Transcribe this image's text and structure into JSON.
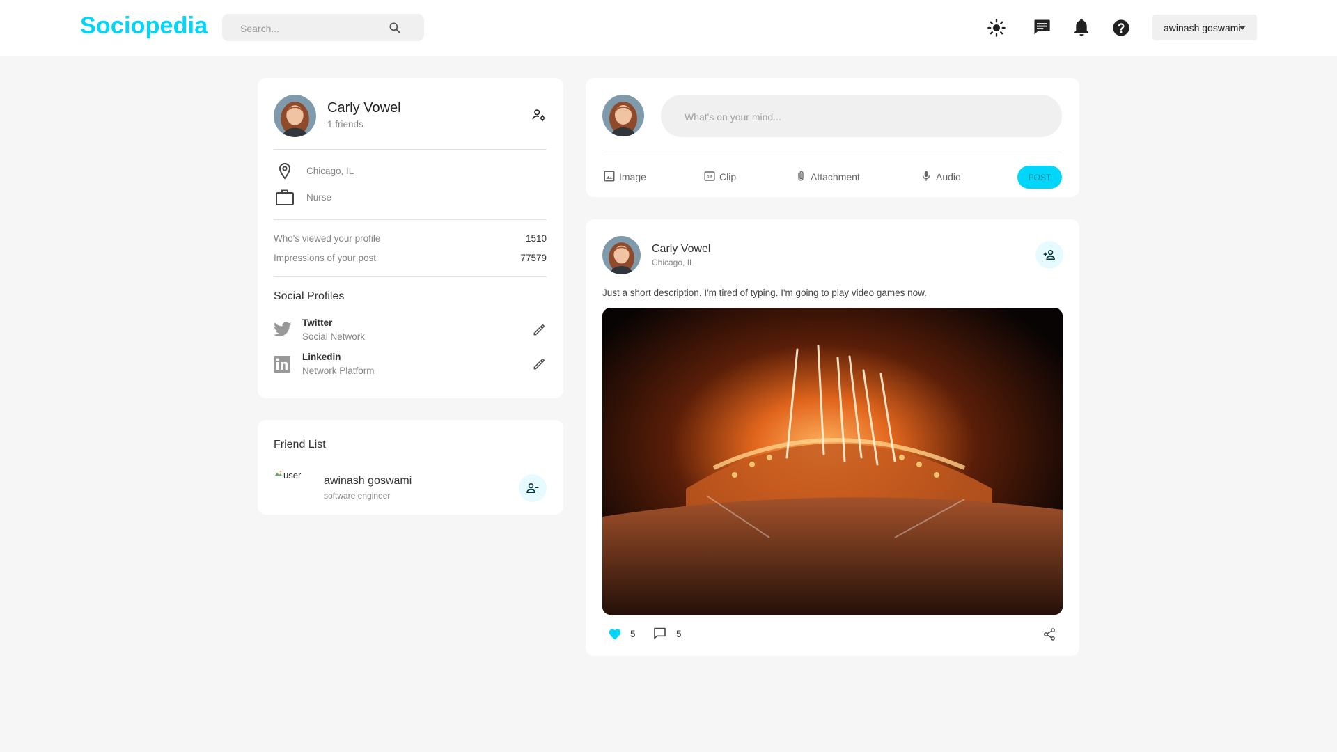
{
  "navbar": {
    "logo": "Sociopedia",
    "search_placeholder": "Search...",
    "user_select": "awinash goswami",
    "icons": [
      "sun-icon",
      "message-icon",
      "bell-icon",
      "help-icon"
    ]
  },
  "profile": {
    "name": "Carly Vowel",
    "friends": "1 friends",
    "location": "Chicago, IL",
    "occupation": "Nurse",
    "stats": [
      {
        "label": "Who's viewed your profile",
        "value": "1510"
      },
      {
        "label": "Impressions of your post",
        "value": "77579"
      }
    ],
    "social_title": "Social Profiles",
    "socials": [
      {
        "name": "Twitter",
        "sub": "Social Network"
      },
      {
        "name": "Linkedin",
        "sub": "Network Platform"
      }
    ]
  },
  "friends_widget": {
    "title": "Friend List",
    "items": [
      {
        "alt": "user",
        "name": "awinash goswami",
        "sub": "software engineer"
      }
    ]
  },
  "composer": {
    "placeholder": "What's on your mind...",
    "options": [
      "Image",
      "Clip",
      "Attachment",
      "Audio"
    ],
    "post_label": "POST"
  },
  "post": {
    "name": "Carly Vowel",
    "location": "Chicago, IL",
    "description": "Just a short description. I'm tired of typing. I'm going to play video games now.",
    "likes": "5",
    "comments": "5"
  },
  "colors": {
    "accent": "#00d5fa",
    "accent_light": "#e6fbff",
    "background": "#f6f6f6",
    "card": "#ffffff"
  }
}
